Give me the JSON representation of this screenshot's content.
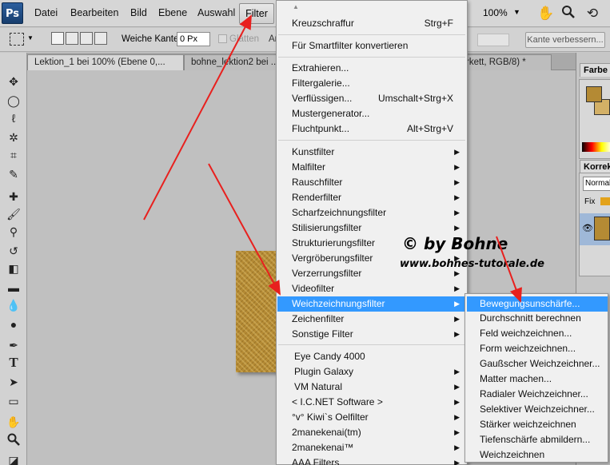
{
  "app": {
    "logo": "Ps",
    "zoom": "100%"
  },
  "menubar": {
    "items": [
      "Datei",
      "Bearbeiten",
      "Bild",
      "Ebene",
      "Auswahl",
      "Filter"
    ]
  },
  "options": {
    "feather_label": "Weiche Kante:",
    "feather_value": "0 Px",
    "smooth_label": "Glätten",
    "style_label_partial": "Ar",
    "refine_edge": "Kante verbessern..."
  },
  "tabs": [
    {
      "label": "Lektion_1 bei 100% (Ebene 0,..."
    },
    {
      "label": "bohne_lektion2 bei ..."
    },
    {
      "label": "rkett, RGB/8) *"
    }
  ],
  "panels": {
    "color_tab": "Farbe",
    "adjust_tab": "Korrekt",
    "blend_mode": "Normal",
    "fix_label": "Fix"
  },
  "filter_menu": {
    "top_items": [
      {
        "label": "Kreuzschraffur",
        "shortcut": "Strg+F"
      },
      {
        "label": "Für Smartfilter konvertieren",
        "shortcut": ""
      }
    ],
    "tool_items": [
      {
        "label": "Extrahieren...",
        "shortcut": ""
      },
      {
        "label": "Filtergalerie...",
        "shortcut": ""
      },
      {
        "label": "Verflüssigen...",
        "shortcut": "Umschalt+Strg+X"
      },
      {
        "label": "Mustergenerator...",
        "shortcut": ""
      },
      {
        "label": "Fluchtpunkt...",
        "shortcut": "Alt+Strg+V"
      }
    ],
    "category_items": [
      "Kunstfilter",
      "Malfilter",
      "Rauschfilter",
      "Renderfilter",
      "Scharfzeichnungsfilter",
      "Stilisierungsfilter",
      "Strukturierungsfilter",
      "Vergröberungsfilter",
      "Verzerrungsfilter",
      "Videofilter",
      "Weichzeichnungsfilter",
      "Zeichenfilter",
      "Sonstige Filter"
    ],
    "plugin_items": [
      {
        "label": "Eye Candy 4000",
        "submenu": false
      },
      {
        "label": "Plugin Galaxy",
        "submenu": true
      },
      {
        "label": "VM Natural",
        "submenu": true
      },
      {
        "label": "< I.C.NET Software >",
        "submenu": true
      },
      {
        "label": "°v° Kiwi`s Oelfilter",
        "submenu": true
      },
      {
        "label": "2manekenai(tm)",
        "submenu": true
      },
      {
        "label": "2manekenai™",
        "submenu": true
      },
      {
        "label": "AAA Filters",
        "submenu": true
      }
    ],
    "highlighted": "Weichzeichnungsfilter"
  },
  "blur_submenu": {
    "items": [
      "Bewegungsunschärfe...",
      "Durchschnitt berechnen",
      "Feld weichzeichnen...",
      "Form weichzeichnen...",
      "Gaußscher Weichzeichner...",
      "Matter machen...",
      "Radialer Weichzeichner...",
      "Selektiver Weichzeichner...",
      "Stärker weichzeichnen",
      "Tiefenschärfe abmildern...",
      "Weichzeichnen"
    ],
    "highlighted": "Bewegungsunschärfe..."
  },
  "watermark": {
    "line1": "© by Bohne",
    "line2": "www.bohnes-tutorale.de"
  },
  "colors": {
    "menu_highlight": "#3399ff",
    "arrow": "#e8201e",
    "texture": "#b48a34"
  },
  "icons": [
    "hand-icon",
    "zoom-icon",
    "rotate-icon",
    "marquee-icon",
    "move-icon",
    "lasso-icon",
    "magic-wand-icon",
    "crop-icon",
    "eyedropper-icon",
    "healing-icon",
    "brush-icon",
    "stamp-icon",
    "history-brush-icon",
    "eraser-icon",
    "gradient-icon",
    "blur-tool-icon",
    "dodge-icon",
    "pen-icon",
    "type-icon",
    "path-select-icon",
    "shape-icon",
    "hand-tool-icon",
    "zoom-tool-icon",
    "eye-icon"
  ]
}
